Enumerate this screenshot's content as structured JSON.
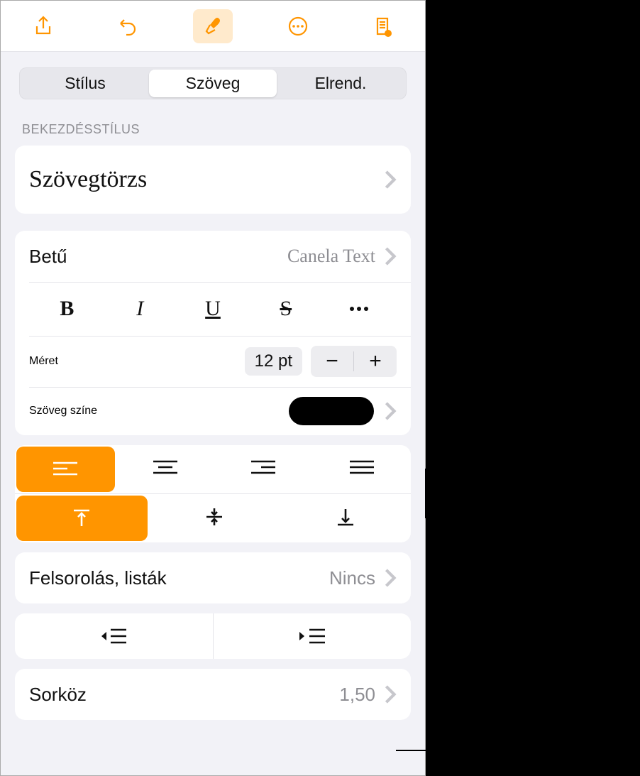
{
  "tabs": {
    "style": "Stílus",
    "text": "Szöveg",
    "arrange": "Elrend."
  },
  "sections": {
    "paragraph_style_label": "Bekezdésstílus"
  },
  "paragraph_style": {
    "name": "Szövegtörzs"
  },
  "font": {
    "label": "Betű",
    "value": "Canela Text"
  },
  "style_glyphs": {
    "bold": "B",
    "italic": "I",
    "underline": "U",
    "strike": "S"
  },
  "size": {
    "label": "Méret",
    "value": "12 pt"
  },
  "text_color": {
    "label": "Szöveg színe",
    "value": "#000000"
  },
  "bullets": {
    "label": "Felsorolás, listák",
    "value": "Nincs"
  },
  "line_spacing": {
    "label": "Sorköz",
    "value": "1,50"
  }
}
